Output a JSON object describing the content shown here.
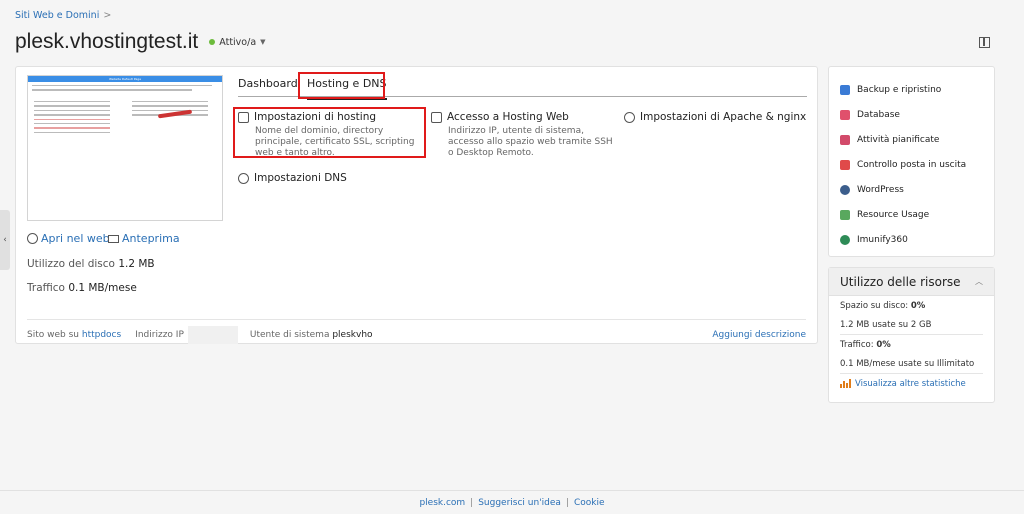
{
  "breadcrumb": {
    "label": "Siti Web e Domini",
    "separator": ">"
  },
  "header": {
    "title": "plesk.vhostingtest.it",
    "status": "Attivo/a",
    "status_color": "#6cbb3c"
  },
  "site": {
    "open_web": "Apri nel web",
    "preview": "Anteprima",
    "thumb_header": "Website Default Page",
    "disk_label": "Utilizzo del disco",
    "disk_value": "1.2 MB",
    "traffic_label": "Traffico",
    "traffic_value": "0.1 MB/mese"
  },
  "tabs": [
    {
      "label": "Dashboard"
    },
    {
      "label": "Hosting e DNS"
    }
  ],
  "services": [
    {
      "title": "Impostazioni di hosting",
      "desc": "Nome del dominio, directory principale, certificato SSL, scripting web e tanto altro.",
      "icon": "sliders-icon"
    },
    {
      "title": "Accesso a Hosting Web",
      "desc": "Indirizzo IP, utente di sistema, accesso allo spazio web tramite SSH o Desktop Remoto.",
      "icon": "key-icon"
    },
    {
      "title": "Impostazioni di Apache & nginx",
      "desc": "",
      "icon": "gears-icon"
    },
    {
      "title": "Impostazioni DNS",
      "desc": "",
      "icon": "globe-icon"
    }
  ],
  "footer_info": {
    "site_label": "Sito web su",
    "site_link": "httpdocs",
    "ip_label": "Indirizzo IP",
    "user_label": "Utente di sistema",
    "user_value": "pleskvho",
    "add_desc": "Aggiungi descrizione"
  },
  "tools": [
    {
      "label": "Backup e ripristino",
      "icon": "backup-icon",
      "color": "#3a7bd5"
    },
    {
      "label": "Database",
      "icon": "database-icon",
      "color": "#e0506c"
    },
    {
      "label": "Attività pianificate",
      "icon": "calendar-icon",
      "color": "#d24a6a"
    },
    {
      "label": "Controllo posta in uscita",
      "icon": "mail-icon",
      "color": "#e04a4a"
    },
    {
      "label": "WordPress",
      "icon": "wordpress-icon",
      "color": "#3c5e8c"
    },
    {
      "label": "Resource Usage",
      "icon": "chart-icon",
      "color": "#59a85e"
    },
    {
      "label": "Imunify360",
      "icon": "shield-icon",
      "color": "#2e8b57"
    }
  ],
  "resources": {
    "title": "Utilizzo delle risorse",
    "disk_label": "Spazio su disco:",
    "disk_pct": "0%",
    "disk_detail": "1.2 MB usate su 2 GB",
    "traffic_label": "Traffico:",
    "traffic_pct": "0%",
    "traffic_detail": "0.1 MB/mese usate su Illimitato",
    "more_stats": "Visualizza altre statistiche"
  },
  "page_footer": {
    "links": [
      "plesk.com",
      "Suggerisci un'idea",
      "Cookie"
    ]
  },
  "colors": {
    "link": "#2a6fb5",
    "highlight": "#e01a1a"
  }
}
